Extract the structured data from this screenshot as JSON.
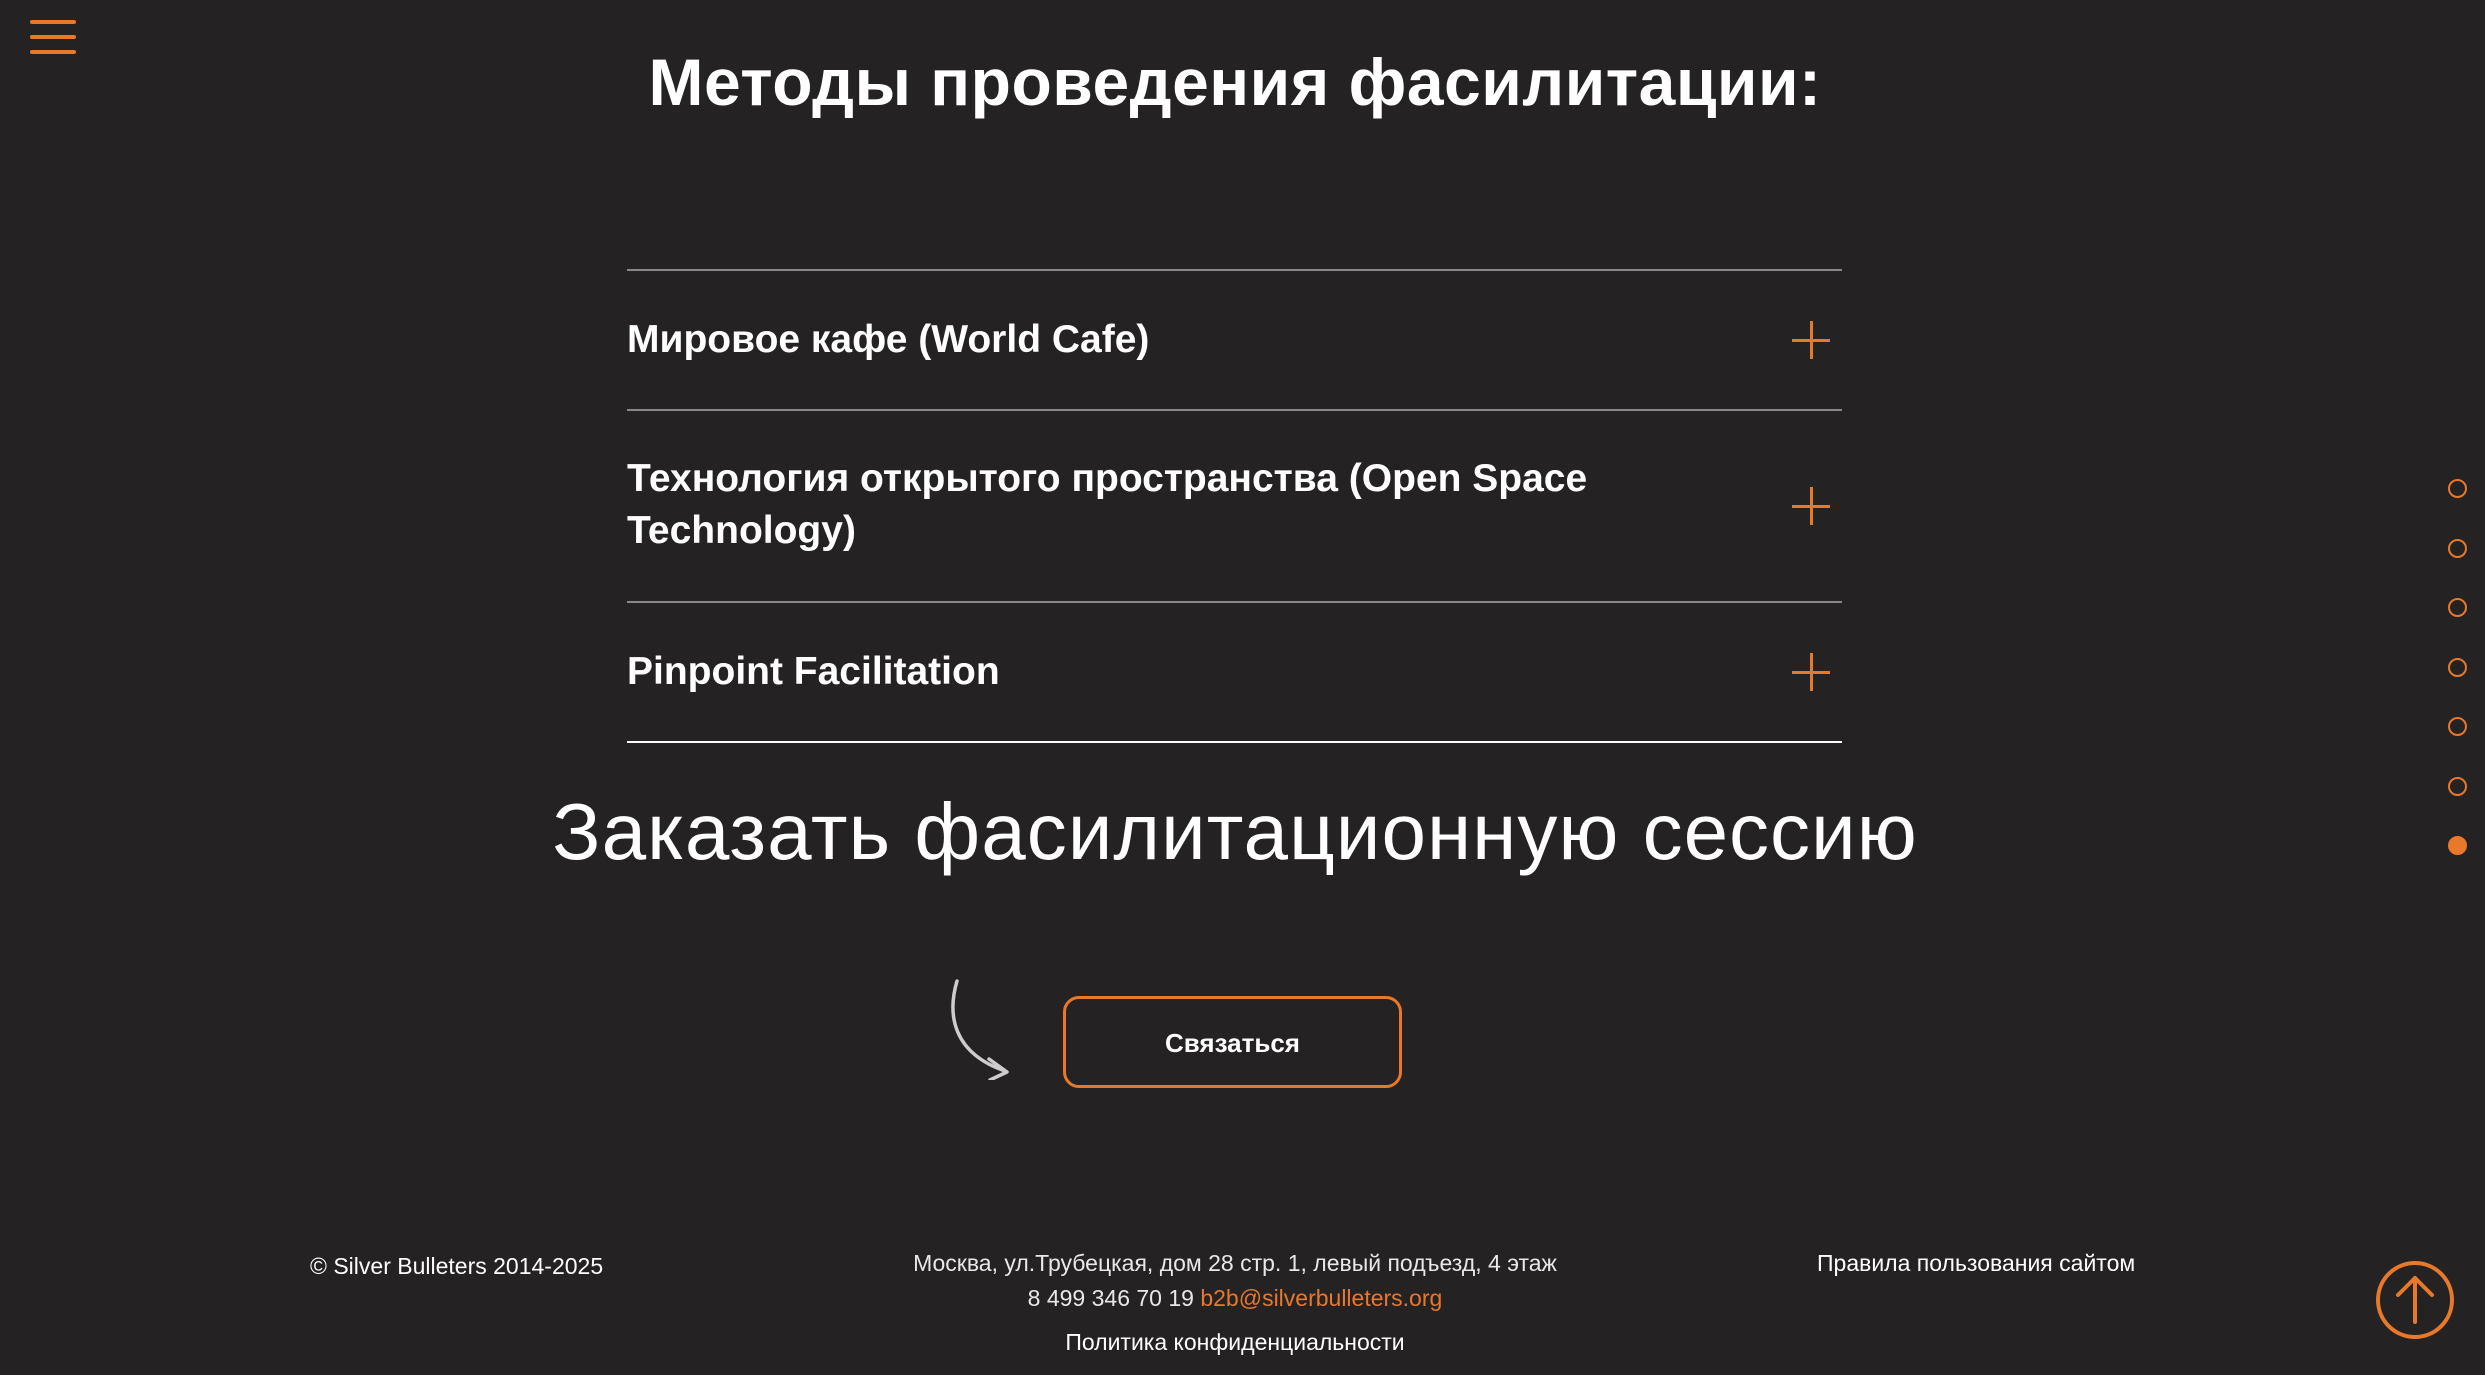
{
  "header": {
    "menu_icon": "hamburger-menu-icon"
  },
  "methods": {
    "title": "Методы проведения фасилитации:",
    "items": [
      {
        "label": "Мировое кафе (World Cafe)",
        "icon": "plus-icon"
      },
      {
        "label": "Технология открытого пространства (Open Space Technology)",
        "icon": "plus-icon"
      },
      {
        "label": "Pinpoint Facilitation",
        "icon": "plus-icon"
      }
    ]
  },
  "order": {
    "title": "Заказать фасилитационную сессию",
    "button_label": "Связаться",
    "arrow_icon": "curved-arrow-icon"
  },
  "pagination": {
    "count": 7,
    "active_index": 6
  },
  "footer": {
    "copyright": "© Silver Bulleters 2014-2025",
    "address": "Москва, ул.Трубецкая, дом 28 стр. 1, левый подъезд, 4 этаж",
    "phone": "8 499 346 70 19",
    "email": "b2b@silverbulleters.org",
    "privacy": "Политика конфиденциальности",
    "rules": "Правила пользования сайтом",
    "to_top_icon": "arrow-up-circle-icon"
  },
  "colors": {
    "background": "#252224",
    "accent": "#e8782a",
    "text": "#ffffff"
  }
}
